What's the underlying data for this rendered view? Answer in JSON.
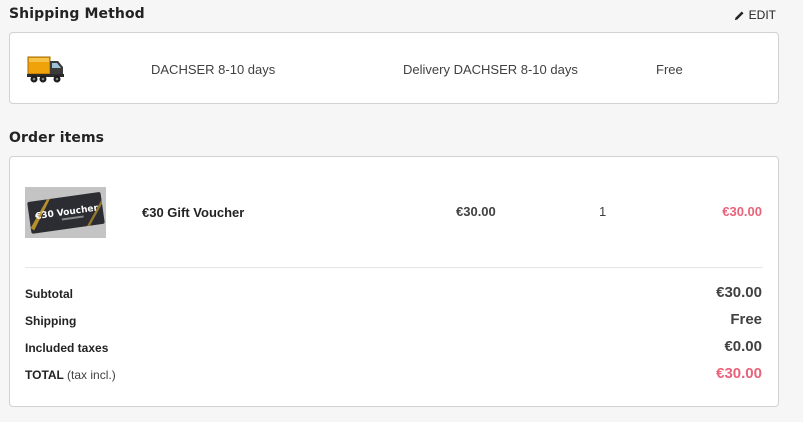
{
  "shipping_section": {
    "title": "Shipping Method",
    "edit_label": "EDIT",
    "carrier": {
      "icon": "truck-icon",
      "name": "DACHSER 8-10 days",
      "delay": "Delivery DACHSER 8-10 days",
      "price": "Free"
    }
  },
  "items_section": {
    "title": "Order items",
    "items": [
      {
        "image_text": "€30 Voucher",
        "name": "€30 Gift Voucher",
        "unit_price": "€30.00",
        "quantity": "1",
        "total": "€30.00"
      }
    ],
    "summary": {
      "subtotal_label": "Subtotal",
      "subtotal_value": "€30.00",
      "shipping_label": "Shipping",
      "shipping_value": "Free",
      "taxes_label": "Included taxes",
      "taxes_value": "€0.00",
      "total_label": "TOTAL",
      "total_suffix": "(tax incl.)",
      "total_value": "€30.00"
    }
  },
  "colors": {
    "accent": "#e8637a",
    "text": "#232323",
    "border": "#d2d2d2",
    "background": "#f6f6f6"
  }
}
